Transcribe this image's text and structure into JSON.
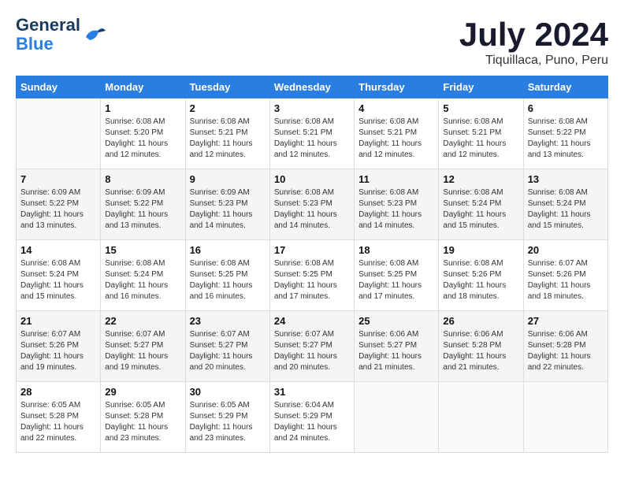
{
  "logo": {
    "line1": "General",
    "line2": "Blue"
  },
  "title": "July 2024",
  "location": "Tiquillaca, Puno, Peru",
  "weekdays": [
    "Sunday",
    "Monday",
    "Tuesday",
    "Wednesday",
    "Thursday",
    "Friday",
    "Saturday"
  ],
  "weeks": [
    [
      {
        "day": "",
        "info": ""
      },
      {
        "day": "1",
        "info": "Sunrise: 6:08 AM\nSunset: 5:20 PM\nDaylight: 11 hours\nand 12 minutes."
      },
      {
        "day": "2",
        "info": "Sunrise: 6:08 AM\nSunset: 5:21 PM\nDaylight: 11 hours\nand 12 minutes."
      },
      {
        "day": "3",
        "info": "Sunrise: 6:08 AM\nSunset: 5:21 PM\nDaylight: 11 hours\nand 12 minutes."
      },
      {
        "day": "4",
        "info": "Sunrise: 6:08 AM\nSunset: 5:21 PM\nDaylight: 11 hours\nand 12 minutes."
      },
      {
        "day": "5",
        "info": "Sunrise: 6:08 AM\nSunset: 5:21 PM\nDaylight: 11 hours\nand 12 minutes."
      },
      {
        "day": "6",
        "info": "Sunrise: 6:08 AM\nSunset: 5:22 PM\nDaylight: 11 hours\nand 13 minutes."
      }
    ],
    [
      {
        "day": "7",
        "info": "Sunrise: 6:09 AM\nSunset: 5:22 PM\nDaylight: 11 hours\nand 13 minutes."
      },
      {
        "day": "8",
        "info": "Sunrise: 6:09 AM\nSunset: 5:22 PM\nDaylight: 11 hours\nand 13 minutes."
      },
      {
        "day": "9",
        "info": "Sunrise: 6:09 AM\nSunset: 5:23 PM\nDaylight: 11 hours\nand 14 minutes."
      },
      {
        "day": "10",
        "info": "Sunrise: 6:08 AM\nSunset: 5:23 PM\nDaylight: 11 hours\nand 14 minutes."
      },
      {
        "day": "11",
        "info": "Sunrise: 6:08 AM\nSunset: 5:23 PM\nDaylight: 11 hours\nand 14 minutes."
      },
      {
        "day": "12",
        "info": "Sunrise: 6:08 AM\nSunset: 5:24 PM\nDaylight: 11 hours\nand 15 minutes."
      },
      {
        "day": "13",
        "info": "Sunrise: 6:08 AM\nSunset: 5:24 PM\nDaylight: 11 hours\nand 15 minutes."
      }
    ],
    [
      {
        "day": "14",
        "info": "Sunrise: 6:08 AM\nSunset: 5:24 PM\nDaylight: 11 hours\nand 15 minutes."
      },
      {
        "day": "15",
        "info": "Sunrise: 6:08 AM\nSunset: 5:24 PM\nDaylight: 11 hours\nand 16 minutes."
      },
      {
        "day": "16",
        "info": "Sunrise: 6:08 AM\nSunset: 5:25 PM\nDaylight: 11 hours\nand 16 minutes."
      },
      {
        "day": "17",
        "info": "Sunrise: 6:08 AM\nSunset: 5:25 PM\nDaylight: 11 hours\nand 17 minutes."
      },
      {
        "day": "18",
        "info": "Sunrise: 6:08 AM\nSunset: 5:25 PM\nDaylight: 11 hours\nand 17 minutes."
      },
      {
        "day": "19",
        "info": "Sunrise: 6:08 AM\nSunset: 5:26 PM\nDaylight: 11 hours\nand 18 minutes."
      },
      {
        "day": "20",
        "info": "Sunrise: 6:07 AM\nSunset: 5:26 PM\nDaylight: 11 hours\nand 18 minutes."
      }
    ],
    [
      {
        "day": "21",
        "info": "Sunrise: 6:07 AM\nSunset: 5:26 PM\nDaylight: 11 hours\nand 19 minutes."
      },
      {
        "day": "22",
        "info": "Sunrise: 6:07 AM\nSunset: 5:27 PM\nDaylight: 11 hours\nand 19 minutes."
      },
      {
        "day": "23",
        "info": "Sunrise: 6:07 AM\nSunset: 5:27 PM\nDaylight: 11 hours\nand 20 minutes."
      },
      {
        "day": "24",
        "info": "Sunrise: 6:07 AM\nSunset: 5:27 PM\nDaylight: 11 hours\nand 20 minutes."
      },
      {
        "day": "25",
        "info": "Sunrise: 6:06 AM\nSunset: 5:27 PM\nDaylight: 11 hours\nand 21 minutes."
      },
      {
        "day": "26",
        "info": "Sunrise: 6:06 AM\nSunset: 5:28 PM\nDaylight: 11 hours\nand 21 minutes."
      },
      {
        "day": "27",
        "info": "Sunrise: 6:06 AM\nSunset: 5:28 PM\nDaylight: 11 hours\nand 22 minutes."
      }
    ],
    [
      {
        "day": "28",
        "info": "Sunrise: 6:05 AM\nSunset: 5:28 PM\nDaylight: 11 hours\nand 22 minutes."
      },
      {
        "day": "29",
        "info": "Sunrise: 6:05 AM\nSunset: 5:28 PM\nDaylight: 11 hours\nand 23 minutes."
      },
      {
        "day": "30",
        "info": "Sunrise: 6:05 AM\nSunset: 5:29 PM\nDaylight: 11 hours\nand 23 minutes."
      },
      {
        "day": "31",
        "info": "Sunrise: 6:04 AM\nSunset: 5:29 PM\nDaylight: 11 hours\nand 24 minutes."
      },
      {
        "day": "",
        "info": ""
      },
      {
        "day": "",
        "info": ""
      },
      {
        "day": "",
        "info": ""
      }
    ]
  ]
}
